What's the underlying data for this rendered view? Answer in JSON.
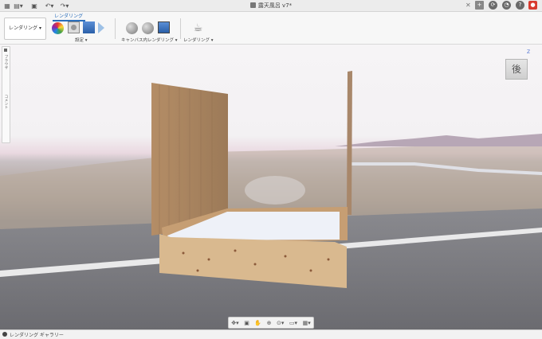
{
  "titlebar": {
    "doc_title": "露天風呂 v7*",
    "close_glyph": "✕"
  },
  "toolbar_icons": [
    "grid-icon",
    "file-icon",
    "save-icon",
    "undo-icon",
    "redo-icon"
  ],
  "right_icons": [
    "add-tab-icon",
    "job-status-icon",
    "notifications-icon",
    "help-icon",
    "account-icon"
  ],
  "ribbon": {
    "workspace": "レンダリング ▾",
    "tab": "レンダリング",
    "groups": {
      "settings": "設定 ▾",
      "canvas_render": "キャンバス内レンダリング ▾",
      "render": "レンダリング ▾"
    }
  },
  "side_panel": {
    "browser": "ブラウザ",
    "comments": "コメント"
  },
  "viewcube": {
    "face": "後",
    "axis": "Z"
  },
  "navbar_icons": [
    "orbit-icon",
    "pan-icon",
    "zoom-icon",
    "fit-icon",
    "display-icon",
    "grid-settings-icon"
  ],
  "status": {
    "gallery": "レンダリング ギャラリー"
  },
  "colors": {
    "accent": "#2a6ebb",
    "close_button": "#d83b2f"
  }
}
